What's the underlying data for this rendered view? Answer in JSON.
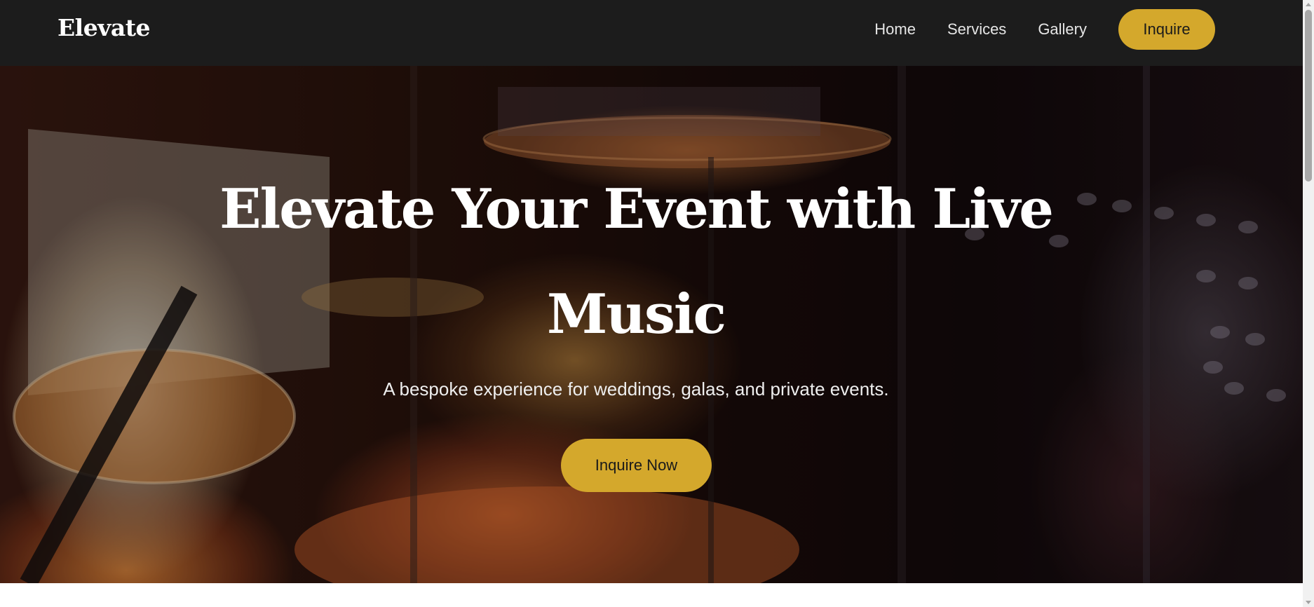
{
  "nav": {
    "logo": "Elevate",
    "links": [
      "Home",
      "Services",
      "Gallery"
    ],
    "cta_label": "Inquire"
  },
  "hero": {
    "title": "Elevate Your Event with Live Music",
    "subtitle": "A bespoke experience for weddings, galas, and private events.",
    "cta_label": "Inquire Now",
    "background_image": "live-drum-kit-on-stage-photo"
  },
  "colors": {
    "nav_bg": "#1c1c1c",
    "accent": "#d4a82c",
    "hero_text": "#ffffff"
  }
}
